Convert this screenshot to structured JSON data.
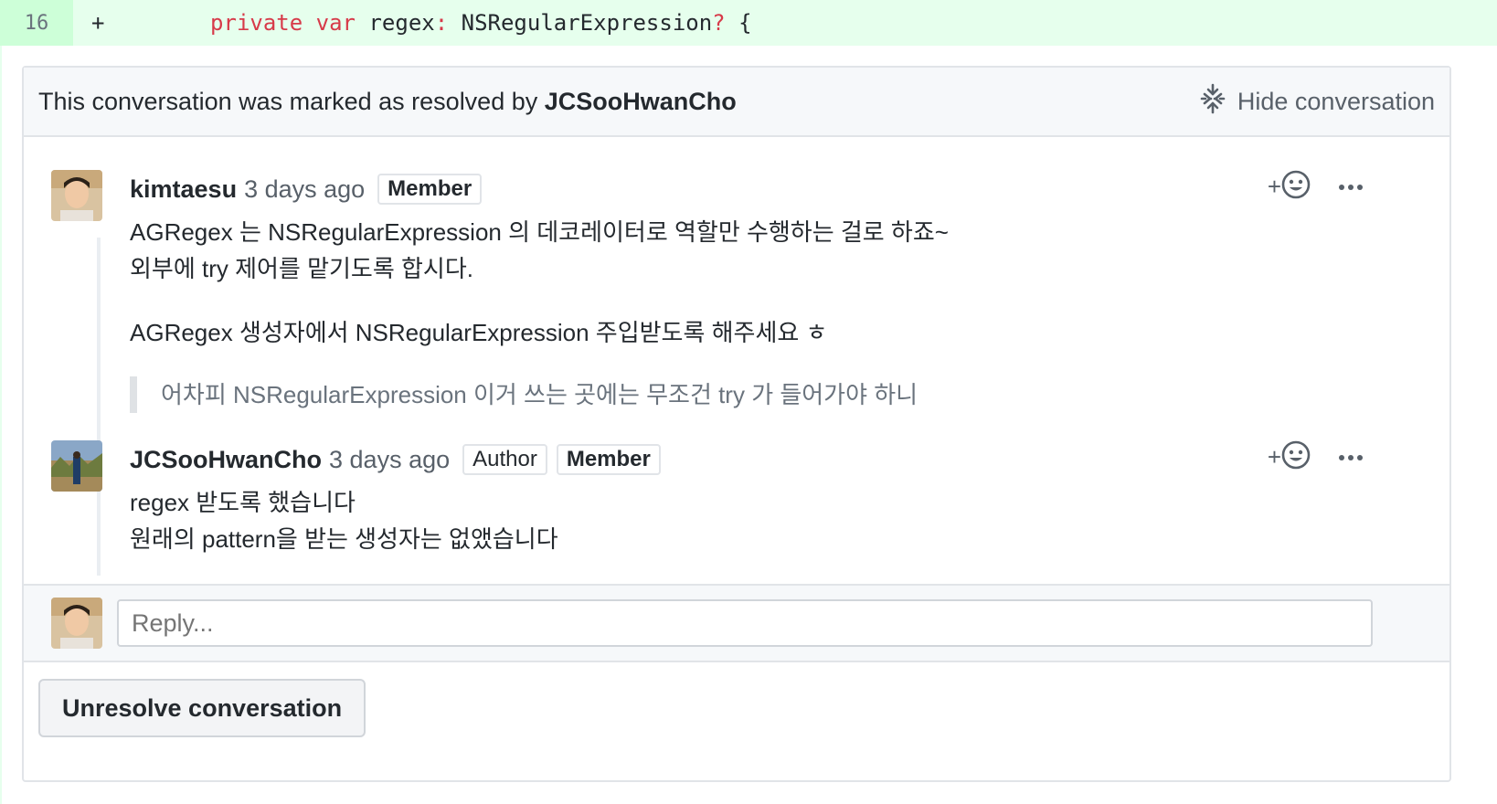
{
  "diff": {
    "line_number": "16",
    "marker": "+",
    "indent": "    ",
    "kw_private": "private",
    "kw_var": "var",
    "name": "regex",
    "colon": ":",
    "type": "NSRegularExpression",
    "optional": "?",
    "brace": "{"
  },
  "resolved": {
    "prefix": "This conversation was marked as resolved by",
    "user": "JCSooHwanCho",
    "hide_label": "Hide conversation"
  },
  "comments": [
    {
      "author": "kimtaesu",
      "time": "3 days ago",
      "badges": [
        "Member"
      ],
      "lines": [
        "AGRegex 는 NSRegularExpression 의 데코레이터로 역할만 수행하는 걸로 하죠~",
        "외부에 try 제어를 맡기도록 합시다.",
        "AGRegex 생성자에서 NSRegularExpression 주입받도록 해주세요 ㅎ"
      ],
      "quote": "어차피 NSRegularExpression 이거 쓰는 곳에는 무조건 try 가 들어가야 하니"
    },
    {
      "author": "JCSooHwanCho",
      "time": "3 days ago",
      "badges": [
        "Author",
        "Member"
      ],
      "lines": [
        "regex 받도록 했습니다",
        "원래의 pattern을 받는 생성자는 없앴습니다"
      ]
    }
  ],
  "reactions": {
    "add_label": "+"
  },
  "reply": {
    "placeholder": "Reply..."
  },
  "unresolve_label": "Unresolve conversation",
  "colors": {
    "diff_bg": "#e6ffed",
    "keyword": "#d73a49",
    "border": "#e1e4e8"
  }
}
